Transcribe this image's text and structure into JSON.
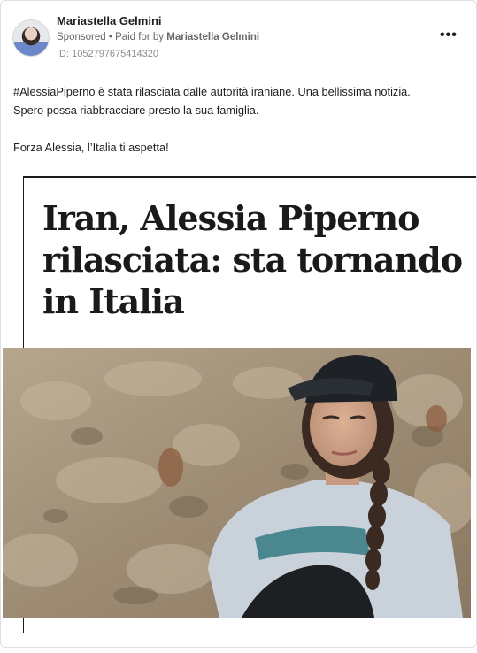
{
  "advertiser": {
    "name": "Mariastella Gelmini",
    "sponsored_label": "Sponsored",
    "separator": "•",
    "paid_for_prefix": "Paid for by",
    "paid_for_name": "Mariastella Gelmini",
    "ad_id": "ID: 1052797675414320",
    "more_label": "•••"
  },
  "post": {
    "line1": "#AlessiaPiperno è stata rilasciata dalle autorità iraniane. Una bellissima notizia.",
    "line2": "Spero possa riabbracciare presto la sua famiglia.",
    "line3": "Forza Alessia, l’Italia ti aspetta!"
  },
  "creative": {
    "headline_line1": "Iran, Alessia Piperno",
    "headline_line2": "rilasciata: sta tornando",
    "headline_line3": "in Italia",
    "photo_subject": "woman-in-cap-with-braid-photo",
    "colors": {
      "rock": "#a2917a",
      "sweater": "#c9d2da",
      "cap": "#1e2226",
      "hair": "#3b2a22",
      "skin": "#d3a88d"
    }
  }
}
